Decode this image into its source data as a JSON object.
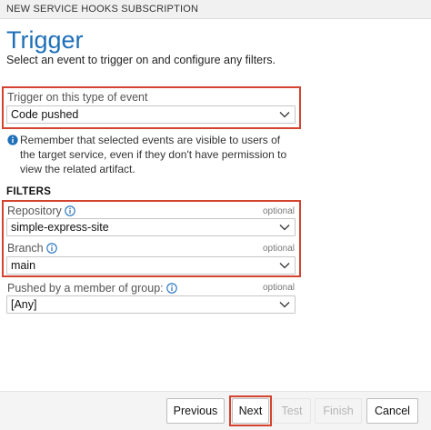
{
  "window": {
    "title": "NEW SERVICE HOOKS SUBSCRIPTION"
  },
  "page": {
    "title": "Trigger",
    "subtitle": "Select an event to trigger on and configure any filters."
  },
  "trigger": {
    "label": "Trigger on this type of event",
    "value": "Code pushed",
    "note": "Remember that selected events are visible to users of the target service, even if they don't have permission to view the related artifact."
  },
  "filters": {
    "header": "FILTERS",
    "repository": {
      "label": "Repository",
      "optional": "optional",
      "value": "simple-express-site"
    },
    "branch": {
      "label": "Branch",
      "optional": "optional",
      "value": "main"
    },
    "pushed_by": {
      "label": "Pushed by a member of group:",
      "optional": "optional",
      "value": "[Any]"
    }
  },
  "footer": {
    "previous": "Previous",
    "next": "Next",
    "test": "Test",
    "finish": "Finish",
    "cancel": "Cancel"
  },
  "colors": {
    "accent": "#1e6fb8",
    "highlight": "#d4432f",
    "info": "#1e6fb8"
  },
  "icons": {
    "info": "info-circle-icon",
    "dropdown": "chevron-down-icon"
  }
}
